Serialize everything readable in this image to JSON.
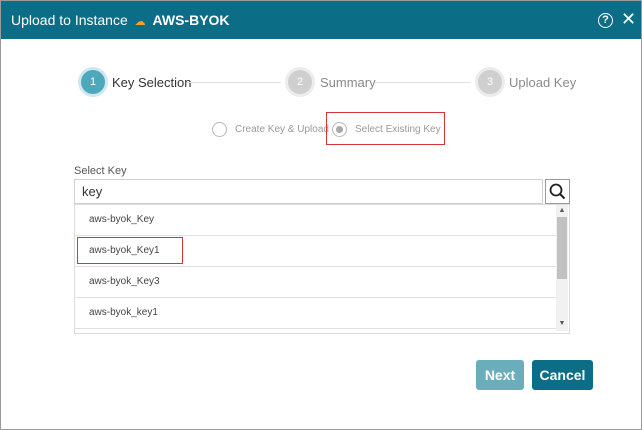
{
  "dialog": {
    "title_prefix": "Upload to Instance",
    "cloud_icon": "cloud-icon",
    "instance_name": "AWS-BYOK",
    "help_glyph": "?",
    "close_glyph": "✕"
  },
  "stepper": {
    "steps": [
      {
        "number": "1",
        "label": "Key Selection",
        "state": "active"
      },
      {
        "number": "2",
        "label": "Summary",
        "state": "inactive"
      },
      {
        "number": "3",
        "label": "Upload Key",
        "state": "inactive"
      }
    ]
  },
  "key_source": {
    "options": [
      {
        "label": "Create Key & Upload",
        "selected": false
      },
      {
        "label": "Select Existing Key",
        "selected": true
      }
    ]
  },
  "select_key": {
    "label": "Select Key",
    "search_value": "key",
    "items": [
      "aws-byok_Key",
      "aws-byok_Key1",
      "aws-byok_Key3",
      "aws-byok_key1"
    ],
    "highlighted_item": "aws-byok_Key1"
  },
  "footer": {
    "next_label": "Next",
    "cancel_label": "Cancel"
  },
  "colors": {
    "header_bg": "#0c6d86",
    "accent": "#4ea8bc",
    "highlight_border": "#d8343a",
    "next_disabled": "#6aaebc"
  }
}
